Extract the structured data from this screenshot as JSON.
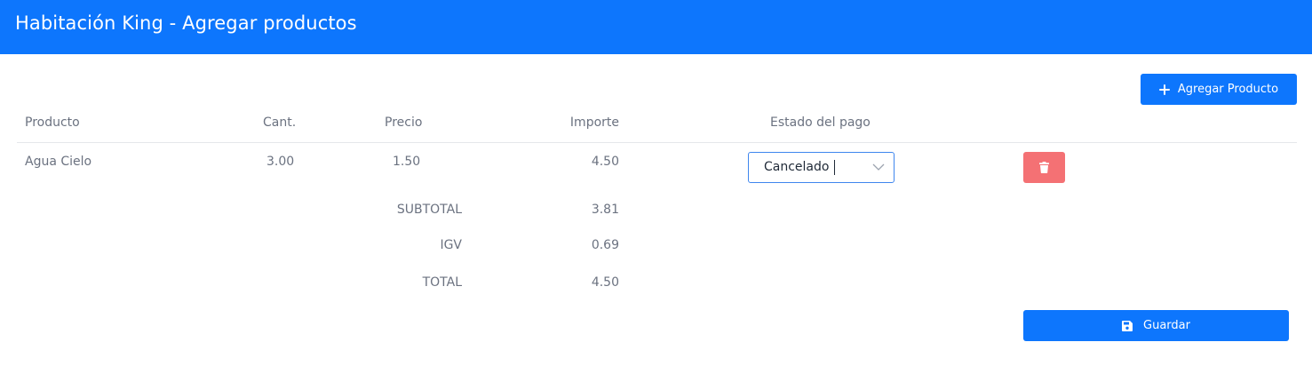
{
  "header": {
    "title": "Habitación King - Agregar productos"
  },
  "toolbar": {
    "add_product_label": "Agregar Producto",
    "add_icon": "plus-icon"
  },
  "table": {
    "columns": {
      "producto": "Producto",
      "cant": "Cant.",
      "precio": "Precio",
      "importe": "Importe",
      "estado": "Estado del pago"
    },
    "rows": [
      {
        "producto": "Agua Cielo",
        "cant": "3.00",
        "precio": "1.50",
        "importe": "4.50",
        "estado": "Cancelado",
        "delete_icon": "trash-icon"
      }
    ]
  },
  "totals": {
    "subtotal_label": "SUBTOTAL",
    "subtotal_value": "3.81",
    "igv_label": "IGV",
    "igv_value": "0.69",
    "total_label": "TOTAL",
    "total_value": "4.50"
  },
  "footer": {
    "save_label": "Guardar",
    "save_icon": "floppy-disk-icon"
  },
  "colors": {
    "primary": "#0d76fd",
    "danger": "#f47174",
    "text_muted": "#6b7280",
    "select_border": "#3f86ee"
  }
}
